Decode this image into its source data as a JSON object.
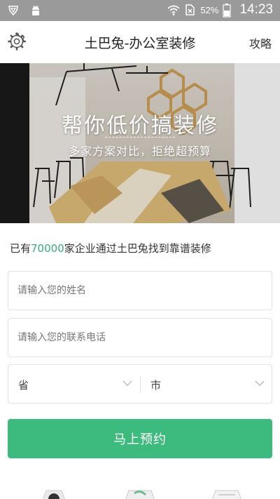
{
  "status_bar": {
    "battery_percent": "52%",
    "time": "14:23"
  },
  "header": {
    "title": "土巴兔-办公室装修",
    "right_link": "攻略",
    "settings_icon": "gear-icon"
  },
  "banner": {
    "title": "帮你低价搞装修",
    "subtitle": "多家方案对比，拒绝超预算"
  },
  "stat": {
    "prefix": "已有",
    "count": "70000",
    "suffix": "家企业通过土巴兔找到靠谱装修",
    "count_color": "#35b07a"
  },
  "form": {
    "name_placeholder": "请输入您的姓名",
    "phone_placeholder": "请输入您的联系电话",
    "province_label": "省",
    "city_label": "市",
    "submit_label": "马上预约"
  },
  "colors": {
    "accent": "#3dbb7e",
    "status_bar": "#9a9a9a"
  }
}
